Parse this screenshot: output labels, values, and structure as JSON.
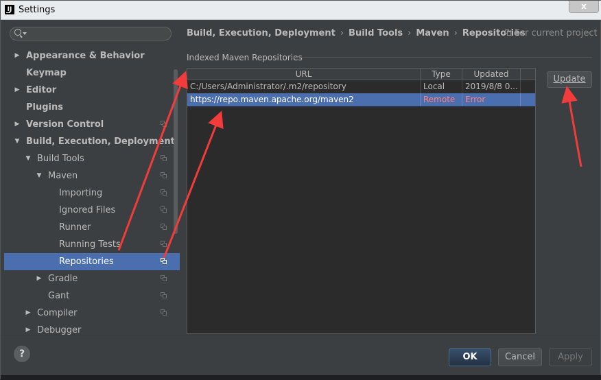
{
  "window": {
    "title": "Settings",
    "close": "x"
  },
  "search": {
    "placeholder": "",
    "value": ""
  },
  "tree": [
    {
      "label": "Appearance & Behavior",
      "bold": true,
      "arrow": "right",
      "indent": 0,
      "icon": false,
      "selected": false
    },
    {
      "label": "Keymap",
      "bold": true,
      "arrow": "",
      "indent": 0,
      "icon": false,
      "selected": false
    },
    {
      "label": "Editor",
      "bold": true,
      "arrow": "right",
      "indent": 0,
      "icon": false,
      "selected": false
    },
    {
      "label": "Plugins",
      "bold": true,
      "arrow": "",
      "indent": 0,
      "icon": false,
      "selected": false
    },
    {
      "label": "Version Control",
      "bold": true,
      "arrow": "right",
      "indent": 0,
      "icon": true,
      "selected": false
    },
    {
      "label": "Build, Execution, Deployment",
      "bold": true,
      "arrow": "down",
      "indent": 0,
      "icon": false,
      "selected": false
    },
    {
      "label": "Build Tools",
      "bold": false,
      "arrow": "down",
      "indent": 1,
      "icon": true,
      "selected": false
    },
    {
      "label": "Maven",
      "bold": false,
      "arrow": "down",
      "indent": 2,
      "icon": true,
      "selected": false
    },
    {
      "label": "Importing",
      "bold": false,
      "arrow": "",
      "indent": 3,
      "icon": true,
      "selected": false
    },
    {
      "label": "Ignored Files",
      "bold": false,
      "arrow": "",
      "indent": 3,
      "icon": true,
      "selected": false
    },
    {
      "label": "Runner",
      "bold": false,
      "arrow": "",
      "indent": 3,
      "icon": true,
      "selected": false
    },
    {
      "label": "Running Tests",
      "bold": false,
      "arrow": "",
      "indent": 3,
      "icon": true,
      "selected": false
    },
    {
      "label": "Repositories",
      "bold": false,
      "arrow": "",
      "indent": 3,
      "icon": true,
      "selected": true
    },
    {
      "label": "Gradle",
      "bold": false,
      "arrow": "right",
      "indent": 2,
      "icon": true,
      "selected": false
    },
    {
      "label": "Gant",
      "bold": false,
      "arrow": "",
      "indent": 2,
      "icon": true,
      "selected": false
    },
    {
      "label": "Compiler",
      "bold": false,
      "arrow": "right",
      "indent": 1,
      "icon": true,
      "selected": false
    },
    {
      "label": "Debugger",
      "bold": false,
      "arrow": "right",
      "indent": 1,
      "icon": false,
      "selected": false
    }
  ],
  "breadcrumb": [
    "Build, Execution, Deployment",
    "Build Tools",
    "Maven",
    "Repositories"
  ],
  "breadcrumb_sep": "›",
  "scope_label": "For current project",
  "section_title": "Indexed Maven Repositories",
  "table": {
    "columns": [
      "URL",
      "Type",
      "Updated"
    ],
    "rows": [
      {
        "url": "C:/Users/Administrator/.m2/repository",
        "type": "Local",
        "updated": "2019/8/8 0...",
        "selected": false,
        "error": false
      },
      {
        "url": "https://repo.maven.apache.org/maven2",
        "type": "Remote",
        "updated": "Error",
        "selected": true,
        "error": true
      }
    ]
  },
  "buttons": {
    "update": "Update",
    "ok": "OK",
    "cancel": "Cancel",
    "apply": "Apply",
    "help": "?"
  },
  "colors": {
    "annotation_arrow": "#f23b3b",
    "selection": "#4b6eaf",
    "error_text": "#ff6b68"
  }
}
